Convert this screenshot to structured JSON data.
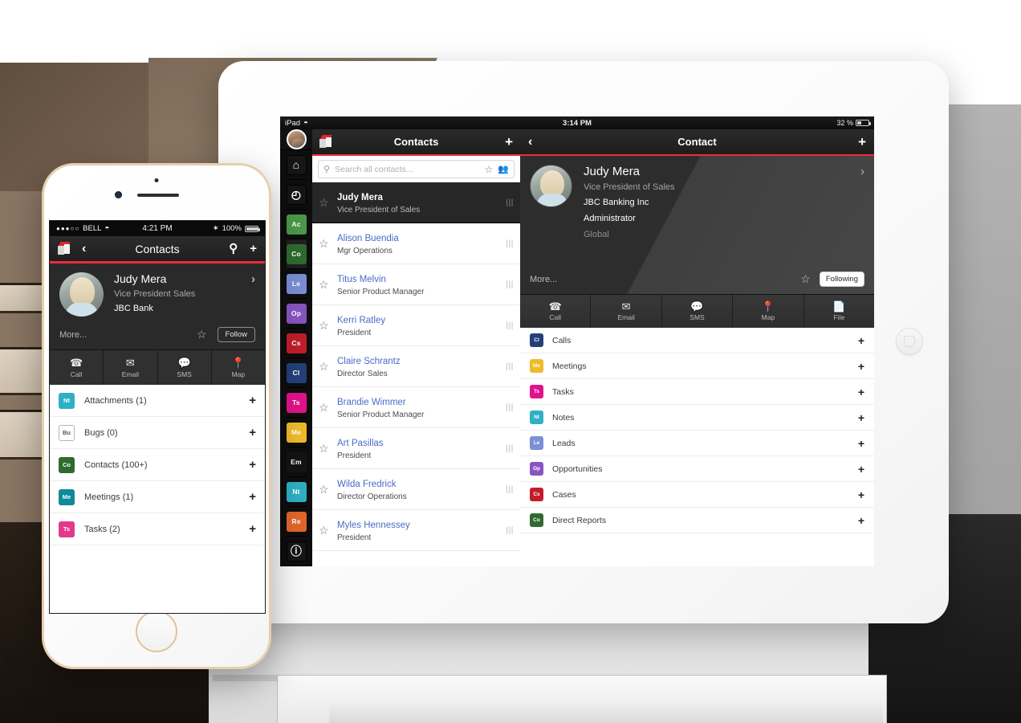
{
  "ipad": {
    "status": {
      "device": "iPad",
      "wifi_icon": "wifi-icon",
      "time": "3:14 PM",
      "battery": "32 %"
    },
    "rail": {
      "avatar": "user-avatar",
      "items": [
        {
          "name": "home",
          "glyph": "⌂",
          "style": "dark",
          "label": ""
        },
        {
          "name": "recent",
          "glyph": "◴",
          "style": "dark",
          "label": ""
        },
        {
          "name": "accounts",
          "style": "tile",
          "label": "Ac",
          "color": "#4a9a4a"
        },
        {
          "name": "contacts",
          "style": "tile",
          "label": "Co",
          "color": "#2f6b2f",
          "selected": true
        },
        {
          "name": "leads",
          "style": "tile",
          "label": "Le",
          "color": "#7a8fd4"
        },
        {
          "name": "opportunities",
          "style": "tile",
          "label": "Op",
          "color": "#8855c0"
        },
        {
          "name": "cases",
          "style": "tile",
          "label": "Cs",
          "color": "#c21d2b"
        },
        {
          "name": "calls",
          "style": "tile",
          "label": "Cl",
          "color": "#24407a"
        },
        {
          "name": "tasks",
          "style": "tile",
          "label": "Ts",
          "color": "#e2128b"
        },
        {
          "name": "meetings",
          "style": "tile",
          "label": "Me",
          "color": "#eebb2a"
        },
        {
          "name": "emails",
          "style": "tile",
          "label": "Em",
          "color": "#141414"
        },
        {
          "name": "notes",
          "style": "tile",
          "label": "Nt",
          "color": "#2fb0c4"
        },
        {
          "name": "reports",
          "style": "tile",
          "label": "Re",
          "color": "#e2662a"
        },
        {
          "name": "info",
          "glyph": "ⓘ",
          "style": "dark",
          "label": ""
        }
      ]
    },
    "list_pane": {
      "title": "Contacts",
      "add_label": "+",
      "logo": "cube-logo",
      "search": {
        "placeholder": "Search all contacts...",
        "search_icon": "search-icon",
        "favorite_icon": "star-icon",
        "team_icon": "people-icon"
      },
      "rows": [
        {
          "name": "Judy Mera",
          "title": "Vice President of Sales",
          "active": true
        },
        {
          "name": "Alison Buendia",
          "title": "Mgr Operations",
          "active": false
        },
        {
          "name": "Titus Melvin",
          "title": "Senior Product Manager",
          "active": false
        },
        {
          "name": "Kerri Ratley",
          "title": "President",
          "active": false
        },
        {
          "name": "Claire Schrantz",
          "title": "Director Sales",
          "active": false
        },
        {
          "name": "Brandie Wimmer",
          "title": "Senior Product Manager",
          "active": false
        },
        {
          "name": "Art Pasillas",
          "title": "President",
          "active": false
        },
        {
          "name": "Wilda Fredrick",
          "title": "Director Operations",
          "active": false
        },
        {
          "name": "Myles Hennessey",
          "title": "President",
          "active": false
        }
      ]
    },
    "detail_pane": {
      "title": "Contact",
      "back_label": "‹",
      "add_label": "+",
      "record": {
        "name": "Judy Mera",
        "title": "Vice President of Sales",
        "account": "JBC Banking Inc",
        "role": "Administrator",
        "team": "Global",
        "more_label": "More...",
        "favorite_icon": "star-icon",
        "follow_label": "Following",
        "chevron": "›"
      },
      "actions": [
        {
          "name": "call",
          "label": "Call",
          "glyph": "☎"
        },
        {
          "name": "email",
          "label": "Email",
          "glyph": "✉"
        },
        {
          "name": "sms",
          "label": "SMS",
          "glyph": "💬"
        },
        {
          "name": "map",
          "label": "Map",
          "glyph": "📍"
        },
        {
          "name": "file",
          "label": "File",
          "glyph": "📄"
        }
      ],
      "related": [
        {
          "label": "Calls",
          "tag": "Cl",
          "color": "#24407a",
          "add": "+"
        },
        {
          "label": "Meetings",
          "tag": "Me",
          "color": "#eebb2a",
          "add": "+"
        },
        {
          "label": "Tasks",
          "tag": "Ts",
          "color": "#e2128b",
          "add": "+"
        },
        {
          "label": "Notes",
          "tag": "Nt",
          "color": "#2fb0c4",
          "add": "+"
        },
        {
          "label": "Leads",
          "tag": "Le",
          "color": "#7a8fd4",
          "add": "+"
        },
        {
          "label": "Opportunities",
          "tag": "Op",
          "color": "#8855c0",
          "add": "+"
        },
        {
          "label": "Cases",
          "tag": "Cs",
          "color": "#c21d2b",
          "add": "+"
        },
        {
          "label": "Direct Reports",
          "tag": "Co",
          "color": "#2f6b2f",
          "add": "+"
        }
      ]
    }
  },
  "iphone": {
    "status": {
      "dots": "●●●○○",
      "carrier": "BELL",
      "wifi_icon": "wifi-icon",
      "time": "4:21 PM",
      "bluetooth": "✶",
      "battery_pct": "100%"
    },
    "nav": {
      "logo": "cube-logo",
      "back_label": "‹",
      "title": "Contacts",
      "search_icon": "search-icon",
      "add_label": "+"
    },
    "record": {
      "name": "Judy Mera",
      "title": "Vice President Sales",
      "account": "JBC Bank",
      "more_label": "More...",
      "favorite_icon": "star-icon",
      "follow_label": "Follow",
      "chevron": "›"
    },
    "actions": [
      {
        "name": "call",
        "label": "Call",
        "glyph": "☎"
      },
      {
        "name": "email",
        "label": "Email",
        "glyph": "✉"
      },
      {
        "name": "sms",
        "label": "SMS",
        "glyph": "💬"
      },
      {
        "name": "map",
        "label": "Map",
        "glyph": "📍"
      }
    ],
    "related": [
      {
        "label": "Attachments (1)",
        "tag": "Nt",
        "color": "#2fb0c4",
        "add": "+",
        "outline": false
      },
      {
        "label": "Bugs (0)",
        "tag": "Bu",
        "color": "#ffffff",
        "add": "+",
        "outline": true
      },
      {
        "label": "Contacts (100+)",
        "tag": "Co",
        "color": "#2f6b2f",
        "add": "+",
        "outline": false
      },
      {
        "label": "Meetings (1)",
        "tag": "Me",
        "color": "#0f8a9a",
        "add": "+",
        "outline": false
      },
      {
        "label": "Tasks (2)",
        "tag": "Ts",
        "color": "#e2398b",
        "add": "+",
        "outline": false
      }
    ]
  },
  "theme": {
    "accent": "#ee2b3b",
    "link": "#4a6bc8",
    "dark": "#2a2a2a"
  }
}
